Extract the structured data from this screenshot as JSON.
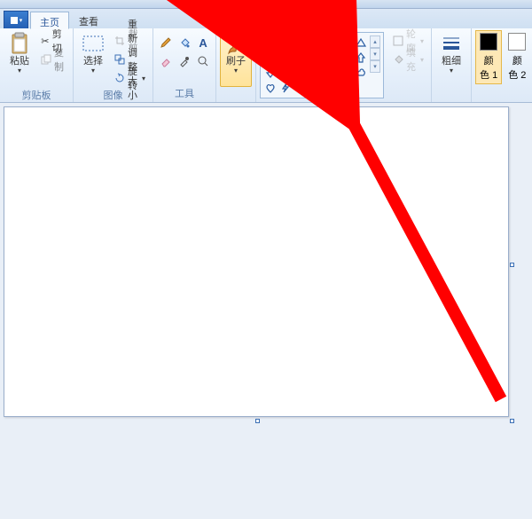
{
  "tabs": {
    "home": "主页",
    "view": "查看"
  },
  "clipboard": {
    "group": "剪贴板",
    "paste": "粘贴",
    "cut": "剪切",
    "copy": "复制"
  },
  "image": {
    "group": "图像",
    "select": "选择",
    "crop": "裁剪",
    "resize": "重新调整大小",
    "rotate": "旋转"
  },
  "tools": {
    "group": "工具"
  },
  "brush": {
    "label": "刷子"
  },
  "shapes_group": {
    "outline": "轮廓",
    "fill": "填充"
  },
  "size": {
    "label": "粗细"
  },
  "colors": {
    "c1": "颜\n色 1",
    "c2": "颜\n色 2",
    "bg1": "#000000",
    "bg2": "#ffffff"
  }
}
